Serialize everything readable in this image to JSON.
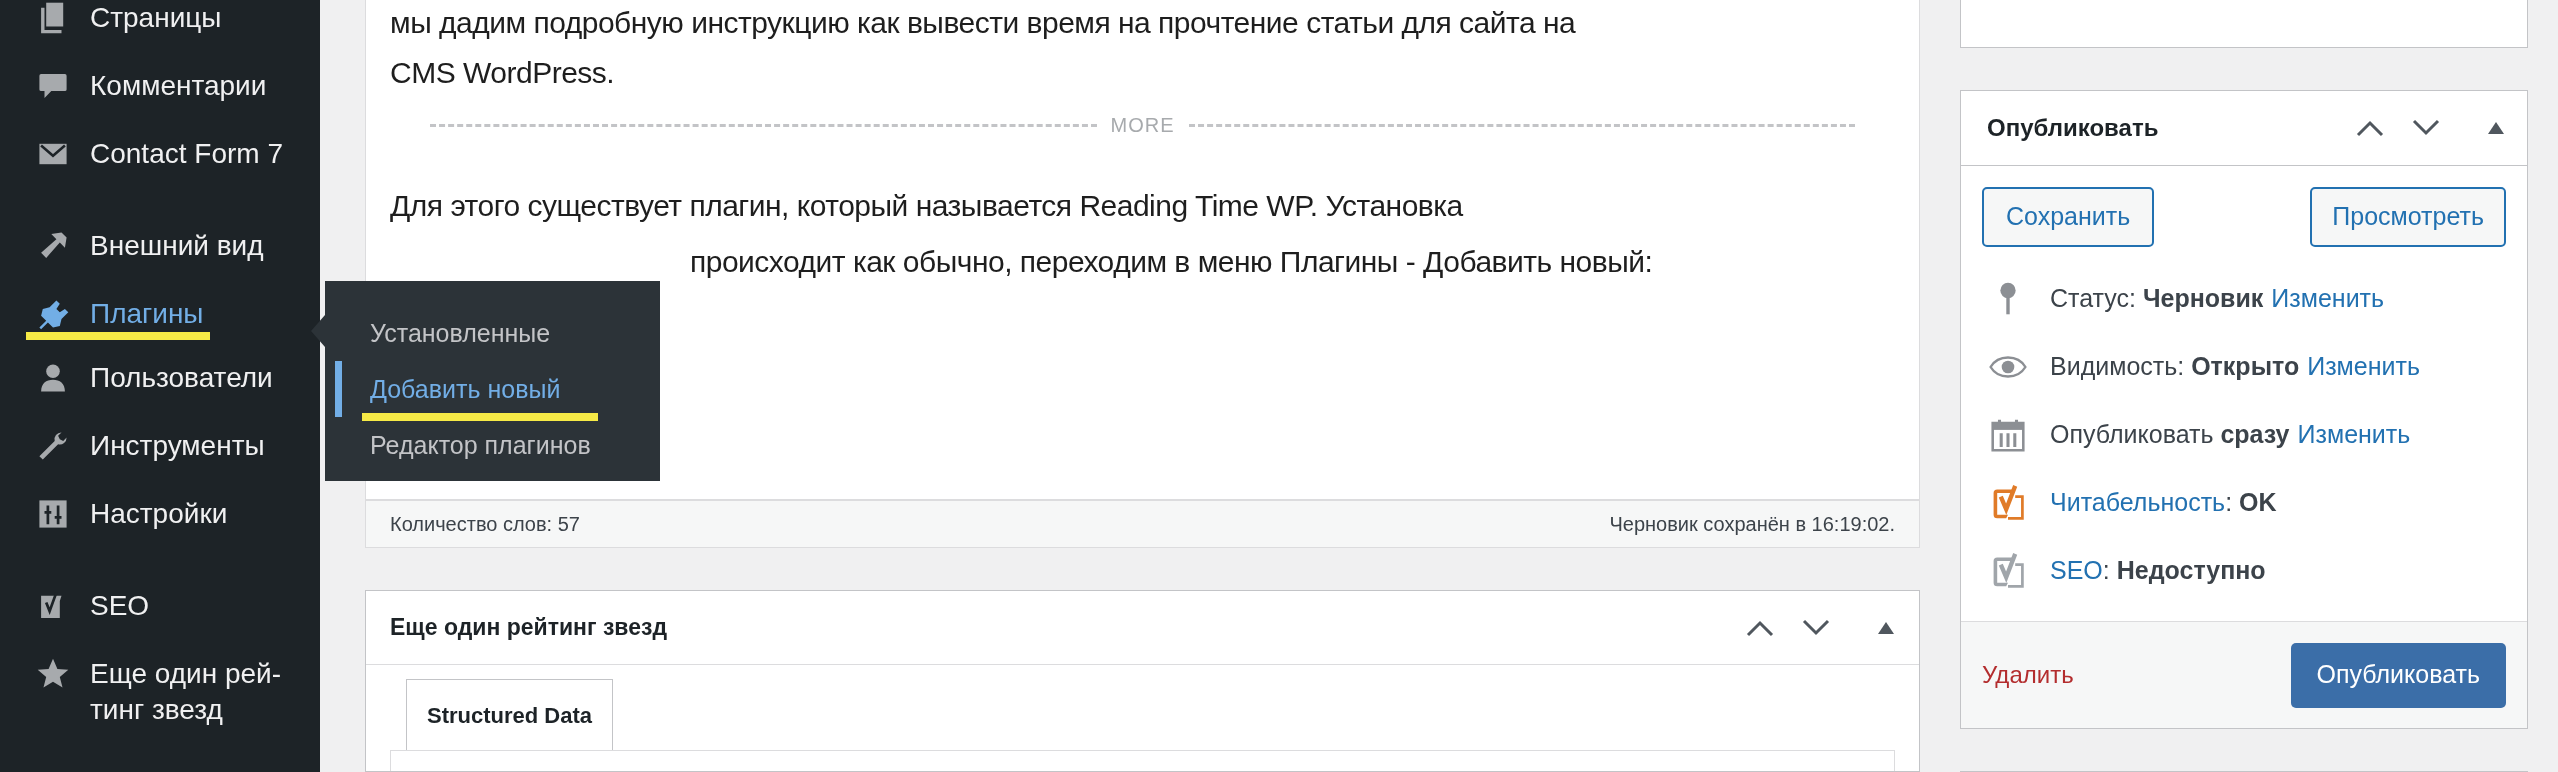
{
  "sidebar": {
    "items": [
      {
        "label": "Страницы",
        "selected": false,
        "kind": "pages"
      },
      {
        "label": "Комментарии",
        "selected": false,
        "kind": "comments"
      },
      {
        "label": "Contact Form 7",
        "selected": false,
        "kind": "mail"
      },
      {
        "label": "Внешний вид",
        "selected": false,
        "kind": "brush",
        "gap": true
      },
      {
        "label": "Плагины",
        "selected": true,
        "kind": "plugin",
        "highlight": true
      },
      {
        "label": "Пользователи",
        "selected": false,
        "kind": "user"
      },
      {
        "label": "Инструменты",
        "selected": false,
        "kind": "wrench"
      },
      {
        "label": "Настройки",
        "selected": false,
        "kind": "settings"
      },
      {
        "label": "SEO",
        "selected": false,
        "kind": "yoast",
        "gap": true
      },
      {
        "label": "Еще один рей-тинг звезд",
        "selected": false,
        "kind": "star"
      }
    ]
  },
  "flyout": {
    "items": [
      {
        "label": "Установленные",
        "selected": false,
        "highlight": false
      },
      {
        "label": "Добавить новый",
        "selected": true,
        "highlight": true
      },
      {
        "label": "Редактор плагинов",
        "selected": false,
        "highlight": false
      }
    ]
  },
  "editor": {
    "paragraphs": [
      {
        "lines": [
          "мы дадим подробную инструкцию как вывести время на прочтение статьи для сайта на",
          "CMS WordPress."
        ]
      },
      {
        "lines": [
          "Для этого существует плагин, который называется Reading Time WP. Установка",
          "происходит как обычно, переходим в меню Плагины - Добавить новый:"
        ]
      }
    ],
    "more_label": "MORE",
    "word_count": "Количество слов: 57",
    "saved_status": "Черновик сохранён в 16:19:02."
  },
  "rating_box": {
    "title": "Еще один рейтинг звезд",
    "tabs": [
      {
        "label": "Structured Data",
        "selected": true
      }
    ]
  },
  "publish_box": {
    "title": "Опубликовать",
    "save_button": "Сохранить",
    "preview_button": "Просмотреть",
    "rows": [
      {
        "kind": "status",
        "text": "Статус: **Черновик**",
        "link": "Изменить"
      },
      {
        "kind": "visibility",
        "text": "Видимость: **Открыто**",
        "link": "Изменить"
      },
      {
        "kind": "schedule",
        "text": "Опубликовать **сразу**",
        "link": "Изменить"
      },
      {
        "kind": "yoast",
        "color": "#e07b28",
        "link": "Читабельность",
        "text": ": **OK**"
      },
      {
        "kind": "yoast",
        "color": "#a0a5aa",
        "link": "SEO",
        "text": ": **Недоступно**"
      }
    ],
    "delete_link": "Удалить",
    "publish_button": "Опубликовать"
  }
}
